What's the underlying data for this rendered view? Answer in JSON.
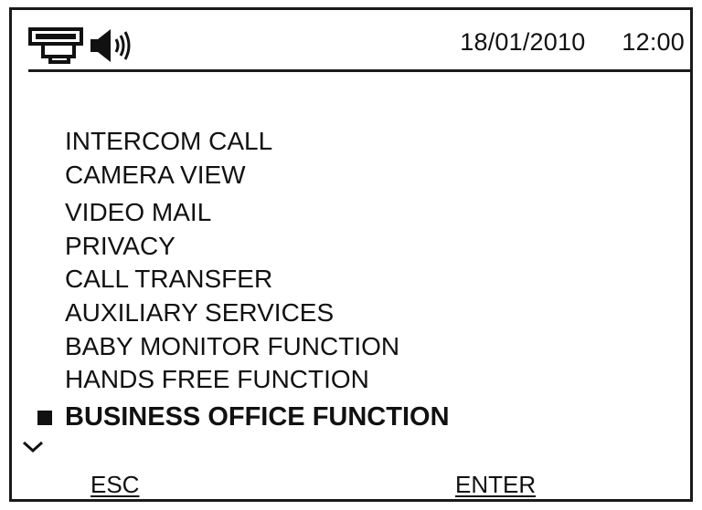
{
  "status": {
    "icons": [
      "intercom-icon",
      "speaker-volume-icon"
    ],
    "date": "18/01/2010",
    "time": "12:00"
  },
  "menu": {
    "items": [
      {
        "label": "INTERCOM CALL"
      },
      {
        "label": "CAMERA VIEW"
      },
      {
        "label": "VIDEO MAIL"
      },
      {
        "label": "PRIVACY"
      },
      {
        "label": "CALL TRANSFER"
      },
      {
        "label": "AUXILIARY SERVICES"
      },
      {
        "label": "BABY MONITOR FUNCTION"
      },
      {
        "label": "HANDS FREE FUNCTION"
      },
      {
        "label": "BUSINESS OFFICE FUNCTION",
        "selected": true
      }
    ],
    "scroll_icon": "chevron-down-icon"
  },
  "softkeys": {
    "left": "ESC ",
    "right": "ENTER "
  }
}
